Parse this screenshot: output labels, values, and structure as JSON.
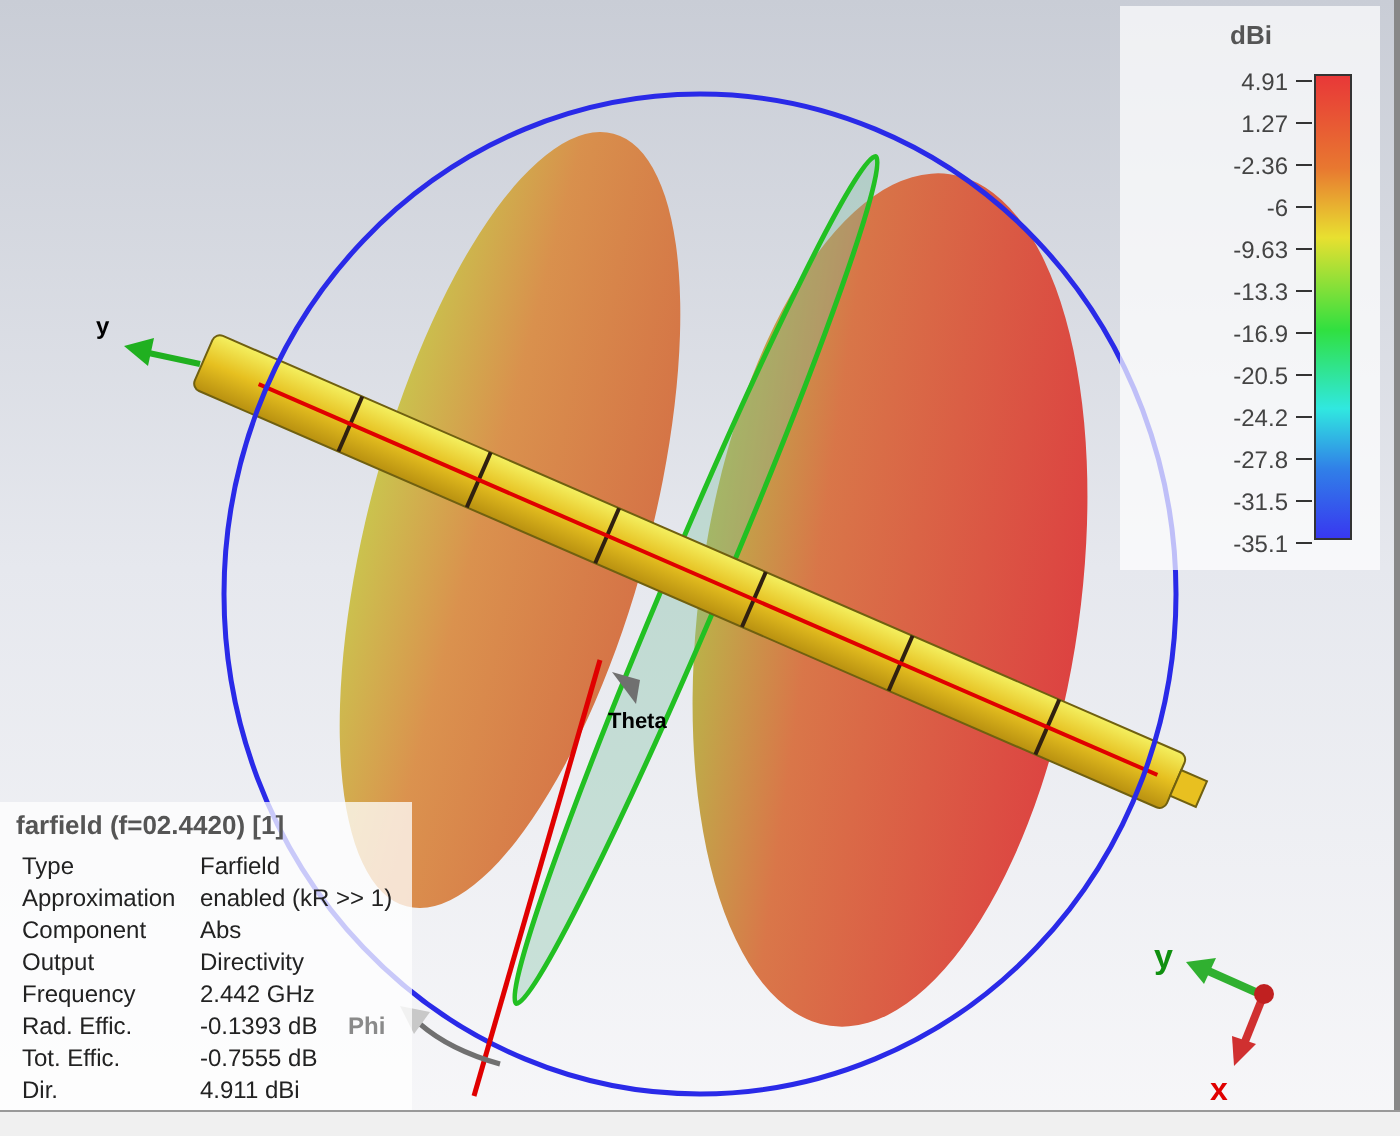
{
  "legend": {
    "unit": "dBi",
    "ticks": [
      "4.91",
      "1.27",
      "-2.36",
      "-6",
      "-9.63",
      "-13.3",
      "-16.9",
      "-20.5",
      "-24.2",
      "-27.8",
      "-31.5",
      "-35.1"
    ]
  },
  "info": {
    "title": "farfield (f=02.4420) [1]",
    "rows": [
      {
        "label": "Type",
        "value": "Farfield"
      },
      {
        "label": "Approximation",
        "value": "enabled (kR >> 1)"
      },
      {
        "label": "Component",
        "value": "Abs"
      },
      {
        "label": "Output",
        "value": "Directivity"
      },
      {
        "label": "Frequency",
        "value": "2.442 GHz"
      },
      {
        "label": "Rad. Effic.",
        "value": "-0.1393 dB"
      },
      {
        "label": "Tot. Effic.",
        "value": "-0.7555 dB"
      },
      {
        "label": "Dir.",
        "value": "4.911 dBi"
      }
    ]
  },
  "scene_labels": {
    "y_axis": "y",
    "theta": "Theta",
    "phi": "Phi"
  },
  "triad": {
    "y": "y",
    "x": "x"
  }
}
